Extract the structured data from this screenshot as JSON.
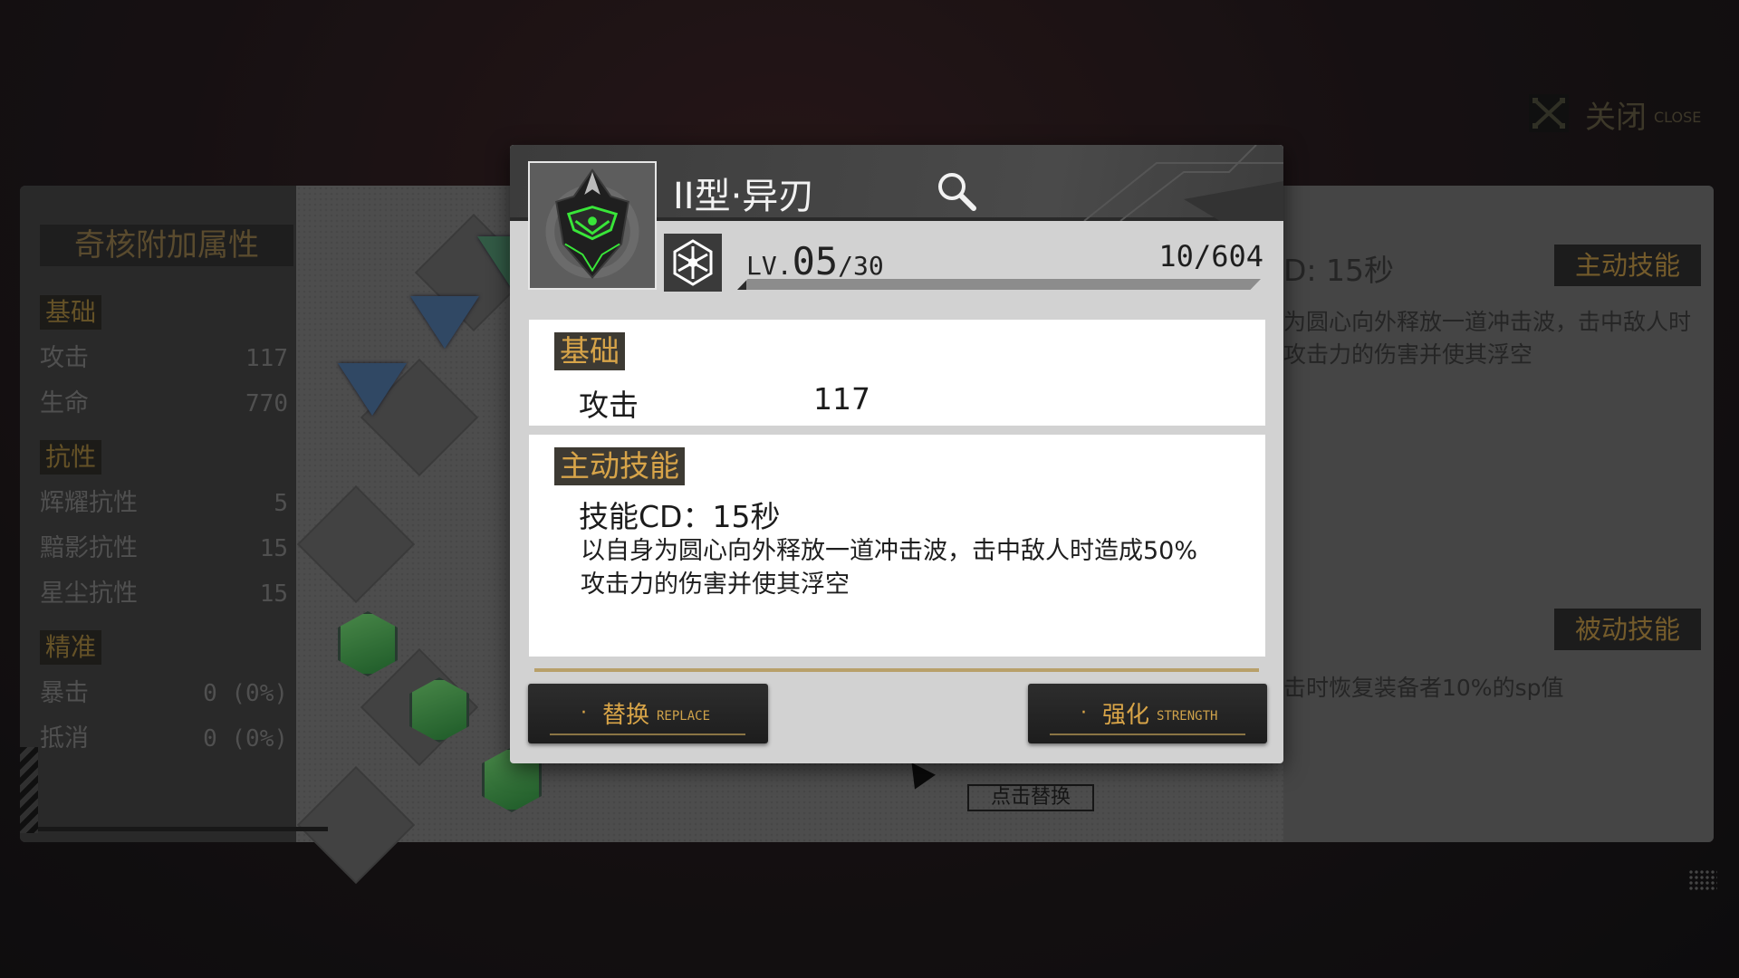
{
  "left_panel": {
    "title": "奇核附加属性",
    "categories": [
      {
        "label": "基础",
        "stats": [
          {
            "name": "攻击",
            "value": "117"
          },
          {
            "name": "生命",
            "value": "770"
          }
        ]
      },
      {
        "label": "抗性",
        "stats": [
          {
            "name": "辉耀抗性",
            "value": "5"
          },
          {
            "name": "黯影抗性",
            "value": "15"
          },
          {
            "name": "星尘抗性",
            "value": "15"
          }
        ]
      },
      {
        "label": "精准",
        "stats": [
          {
            "name": "暴击",
            "value": "0 (0%)"
          },
          {
            "name": "抵消",
            "value": "0 (0%)"
          }
        ]
      }
    ]
  },
  "right_panel": {
    "active_tag": "主动技能",
    "cd_fragment": "D: 15秒",
    "desc_line1": "为圆心向外释放一道冲击波，击中敌人时",
    "desc_line2": "攻击力的伤害并使其浮空",
    "passive_tag": "被动技能",
    "passive_desc": "击时恢复装备者10%的sp值"
  },
  "hint": "点击替换",
  "close": {
    "label": "关闭",
    "sub": "CLOSE"
  },
  "dialog": {
    "title": "II型·异刃",
    "level_prefix": "LV.",
    "level": "05",
    "level_max": "/30",
    "exp_text": "10/604",
    "exp_fraction": 0.0166,
    "basic": {
      "tag": "基础",
      "stat_name": "攻击",
      "stat_value": "117"
    },
    "skill": {
      "tag": "主动技能",
      "cd": "技能CD：15秒",
      "desc_line1": "以自身为圆心向外释放一道冲击波，击中敌人时造成50%",
      "desc_line2": "攻击力的伤害并使其浮空"
    },
    "replace_btn": {
      "cn": "替换",
      "en": "REPLACE"
    },
    "strength_btn": {
      "cn": "强化",
      "en": "STRENGTH"
    },
    "dot": "·"
  },
  "colors": {
    "accent_gold": "#d7a449",
    "dialog_bg": "#d2d2d2",
    "header_bg": "#3c3c3c",
    "neon_green": "#39e639"
  }
}
